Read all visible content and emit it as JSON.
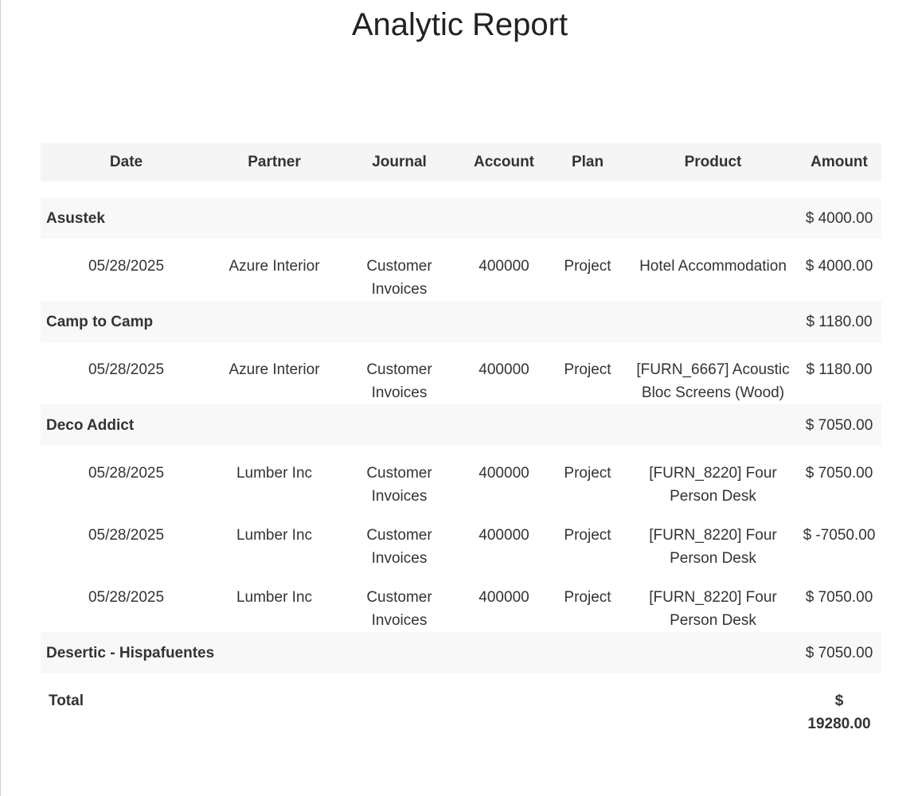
{
  "report": {
    "title": "Analytic Report"
  },
  "table": {
    "headers": [
      "Date",
      "Partner",
      "Journal",
      "Account",
      "Plan",
      "Product",
      "Amount"
    ],
    "groups": [
      {
        "name": "Asustek",
        "amount": "$ 4000.00",
        "lines": [
          {
            "date": "05/28/2025",
            "partner": "Azure Interior",
            "journal": "Customer Invoices",
            "account": "400000",
            "plan": "Project",
            "product": "Hotel Accommodation",
            "amount": "$ 4000.00"
          }
        ]
      },
      {
        "name": "Camp to Camp",
        "amount": "$ 1180.00",
        "lines": [
          {
            "date": "05/28/2025",
            "partner": "Azure Interior",
            "journal": "Customer Invoices",
            "account": "400000",
            "plan": "Project",
            "product": "[FURN_6667] Acoustic Bloc Screens (Wood)",
            "amount": "$ 1180.00"
          }
        ]
      },
      {
        "name": "Deco Addict",
        "amount": "$ 7050.00",
        "lines": [
          {
            "date": "05/28/2025",
            "partner": "Lumber Inc",
            "journal": "Customer Invoices",
            "account": "400000",
            "plan": "Project",
            "product": "[FURN_8220] Four Person Desk",
            "amount": "$ 7050.00"
          },
          {
            "date": "05/28/2025",
            "partner": "Lumber Inc",
            "journal": "Customer Invoices",
            "account": "400000",
            "plan": "Project",
            "product": "[FURN_8220] Four Person Desk",
            "amount": "$ -7050.00"
          },
          {
            "date": "05/28/2025",
            "partner": "Lumber Inc",
            "journal": "Customer Invoices",
            "account": "400000",
            "plan": "Project",
            "product": "[FURN_8220] Four Person Desk",
            "amount": "$ 7050.00"
          }
        ]
      },
      {
        "name": "Desertic - Hispafuentes",
        "amount": "$ 7050.00",
        "lines": []
      }
    ],
    "total": {
      "label": "Total",
      "amount": "$ 19280.00"
    }
  }
}
